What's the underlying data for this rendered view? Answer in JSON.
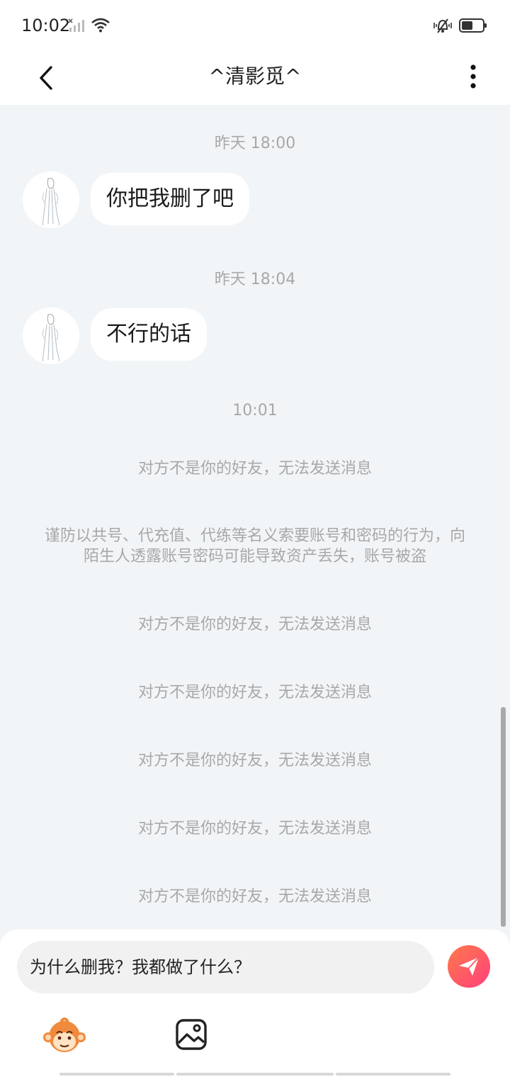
{
  "status_bar": {
    "time": "10:02",
    "icons": [
      "signal-icon",
      "wifi-icon",
      "silent-bell-icon",
      "battery-icon"
    ]
  },
  "header": {
    "title": "^清影觅^",
    "back_icon": "chevron-left-icon",
    "more_icon": "more-vertical-icon"
  },
  "chat": {
    "time_labels": [
      "昨天 18:00",
      "昨天 18:04",
      "10:01"
    ],
    "messages": [
      {
        "text": "你把我删了吧"
      },
      {
        "text": "不行的话"
      }
    ],
    "system_notices": [
      "对方不是你的好友，无法发送消息",
      "谨防以共号、代充值、代练等名义索要账号和密码的行为，向陌生人透露账号密码可能导致资产丢失，账号被盗",
      "对方不是你的好友，无法发送消息",
      "对方不是你的好友，无法发送消息",
      "对方不是你的好友，无法发送消息",
      "对方不是你的好友，无法发送消息",
      "对方不是你的好友，无法发送消息"
    ]
  },
  "input": {
    "value": "为什么删我？我都做了什么？",
    "send_icon": "paper-plane-icon",
    "emoji_icon": "monkey-emoji-icon",
    "image_icon": "image-icon"
  },
  "colors": {
    "background": "#f2f5f7",
    "system_text": "#a8a8a8",
    "send_gradient_start": "#ff7a4a",
    "send_gradient_end": "#ff3f7c"
  }
}
